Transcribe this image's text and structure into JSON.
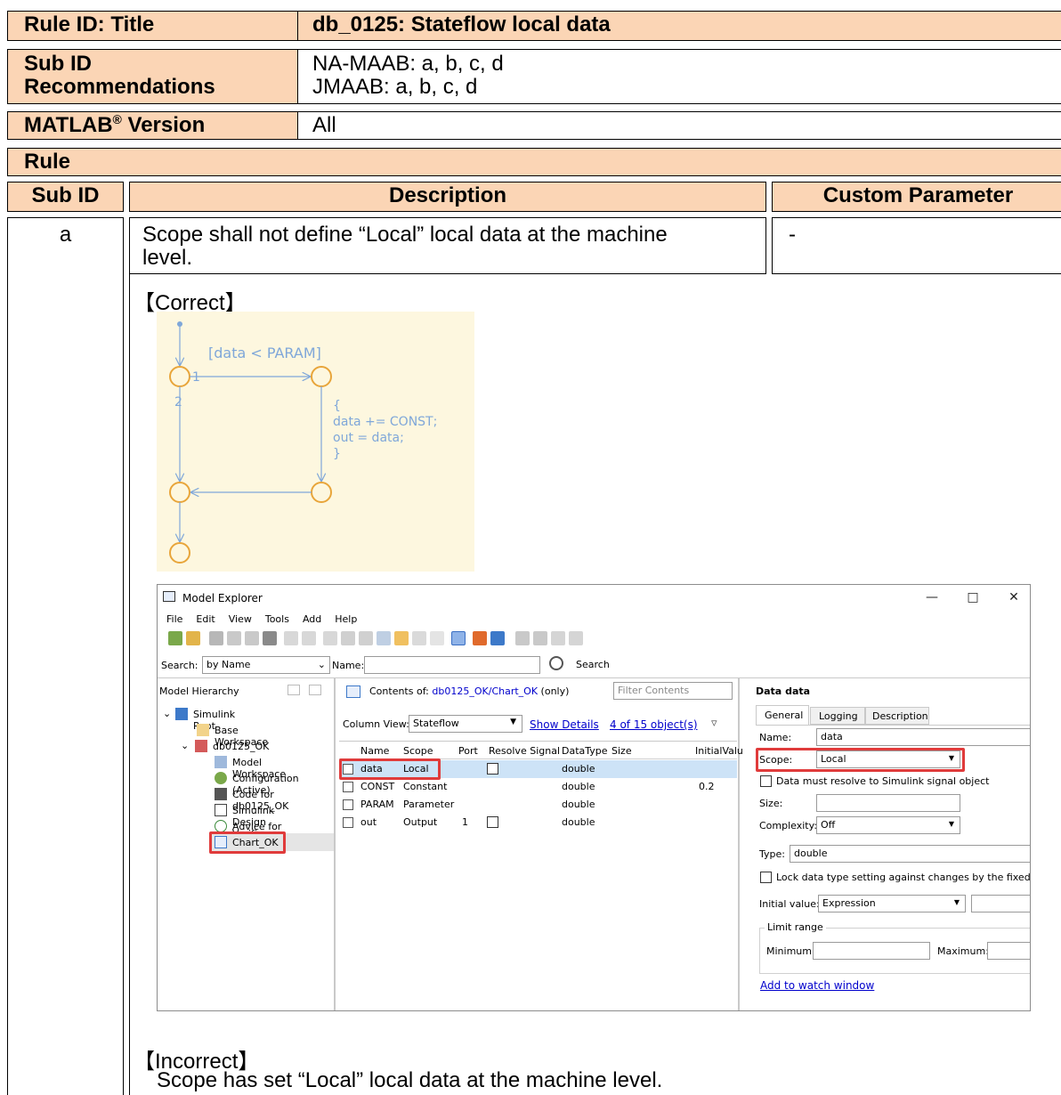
{
  "rule_id_label": "Rule ID: Title",
  "rule_id_value": "db_0125: Stateflow local data",
  "sub_id_rec_label_1": "Sub ID",
  "sub_id_rec_label_2": "Recommendations",
  "sub_id_rec_value_1": "NA-MAAB: a, b, c, d",
  "sub_id_rec_value_2": "JMAAB: a, b, c, d",
  "matlab_label": "MATLAB",
  "matlab_reg": "®",
  "matlab_label_2": " Version",
  "matlab_value": "All",
  "rule_label": "Rule",
  "col_subid": "Sub ID",
  "col_description": "Description",
  "col_custom": "Custom Parameter",
  "row_a": {
    "sub_id": "a",
    "description_line1": "Scope shall not define “Local” local data at the machine",
    "description_line2": "level.",
    "custom": "-"
  },
  "correct_label": "【Correct】",
  "incorrect_label": "【Incorrect】",
  "incorrect_text": "Scope has set “Local” local data at the machine level.",
  "chart": {
    "cond": "[data < PARAM]",
    "t1": "1",
    "t2": "2",
    "action_1": "{",
    "action_2": "data += CONST;",
    "action_3": "out = data;",
    "action_4": "}"
  },
  "mx": {
    "title": "Model Explorer",
    "menus": [
      "File",
      "Edit",
      "View",
      "Tools",
      "Add",
      "Help"
    ],
    "search_label": "Search:",
    "search_value": "by Name",
    "name_label": "Name:",
    "search_button": "Search",
    "hierarchy_label": "Model Hierarchy",
    "tree": {
      "root": "Simulink Root",
      "base_ws": "Base Workspace",
      "model": "db0125_OK",
      "model_ws": "Model Workspace",
      "config": "Configuration (Active)",
      "code": "Code for db0125_OK",
      "sldv": "Simulink Design Verifier",
      "advice": "Advice for db0125_OK",
      "chart": "Chart_OK"
    },
    "contents_prefix": "Contents of:",
    "contents_path": "db0125_OK/Chart_OK",
    "contents_suffix": "(only)",
    "filter_placeholder": "Filter Contents",
    "column_view_label": "Column View:",
    "column_view_value": "Stateflow",
    "show_details": "Show Details",
    "object_count": "4 of 15 object(s)",
    "columns": [
      "Name",
      "Scope",
      "Port",
      "Resolve Signal",
      "DataType",
      "Size",
      "InitialValu"
    ],
    "rows": [
      {
        "name": "data",
        "scope": "Local",
        "port": "",
        "dtype": "double",
        "init": ""
      },
      {
        "name": "CONST",
        "scope": "Constant",
        "port": "",
        "dtype": "double",
        "init": "0.2"
      },
      {
        "name": "PARAM",
        "scope": "Parameter",
        "port": "",
        "dtype": "double",
        "init": ""
      },
      {
        "name": "out",
        "scope": "Output",
        "port": "1",
        "dtype": "double",
        "init": ""
      }
    ],
    "props": {
      "title": "Data data",
      "tabs": [
        "General",
        "Logging",
        "Description"
      ],
      "name_label": "Name:",
      "name_value": "data",
      "scope_label": "Scope:",
      "scope_value": "Local",
      "resolve_label": "Data must resolve to Simulink signal object",
      "size_label": "Size:",
      "complexity_label": "Complexity:",
      "complexity_value": "Off",
      "type_label": "Type:",
      "type_value": "double",
      "lock_label": "Lock data type setting against changes by the fixed-point",
      "initial_label": "Initial value:",
      "initial_value": "Expression",
      "limit_label": "Limit range",
      "min_label": "Minimum:",
      "max_label": "Maximum:",
      "watch_link": "Add to watch window"
    }
  }
}
